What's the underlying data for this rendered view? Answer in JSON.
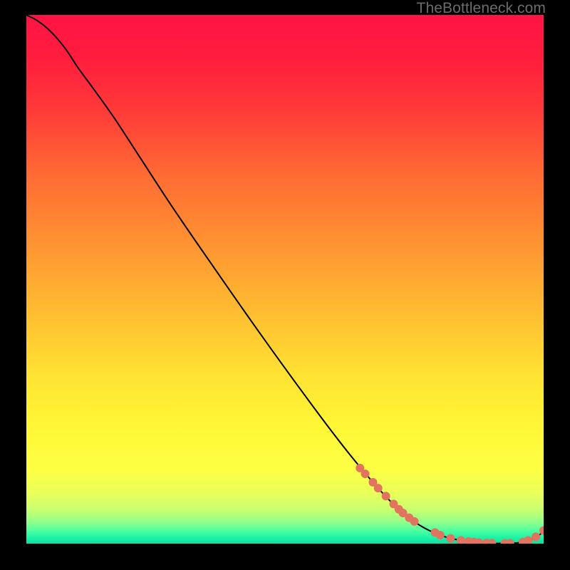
{
  "attribution": "TheBottleneck.com",
  "chart_data": {
    "type": "line",
    "title": "",
    "xlabel": "",
    "ylabel": "",
    "xlim": [
      0,
      100
    ],
    "ylim": [
      0,
      100
    ],
    "gradient_stops": [
      {
        "offset": 0.0,
        "color": "#ff1444"
      },
      {
        "offset": 0.08,
        "color": "#ff1d3e"
      },
      {
        "offset": 0.18,
        "color": "#ff3a38"
      },
      {
        "offset": 0.3,
        "color": "#ff6a34"
      },
      {
        "offset": 0.42,
        "color": "#ff8f32"
      },
      {
        "offset": 0.55,
        "color": "#ffb931"
      },
      {
        "offset": 0.68,
        "color": "#ffe233"
      },
      {
        "offset": 0.78,
        "color": "#fff735"
      },
      {
        "offset": 0.86,
        "color": "#fdff45"
      },
      {
        "offset": 0.905,
        "color": "#e9ff5a"
      },
      {
        "offset": 0.935,
        "color": "#c9ff6f"
      },
      {
        "offset": 0.958,
        "color": "#95ff88"
      },
      {
        "offset": 0.975,
        "color": "#50ffa0"
      },
      {
        "offset": 0.99,
        "color": "#18f2a6"
      },
      {
        "offset": 1.0,
        "color": "#13daa2"
      }
    ],
    "curve": {
      "x": [
        0,
        2,
        4,
        6,
        8,
        10,
        13,
        17,
        22,
        28,
        35,
        45,
        55,
        62,
        68,
        72,
        76,
        80,
        84,
        88,
        92,
        95,
        97,
        99,
        100
      ],
      "y": [
        100,
        99,
        97.5,
        95.5,
        93,
        90,
        86,
        80.5,
        73,
        64,
        54,
        40,
        26.5,
        17.5,
        10.5,
        6.5,
        3.5,
        1.6,
        0.6,
        0.1,
        0.05,
        0.15,
        0.6,
        1.5,
        2.5
      ]
    },
    "markers": {
      "x": [
        64.5,
        65.5,
        67,
        68,
        69.5,
        71,
        72,
        72.8,
        74,
        75,
        79,
        80,
        82,
        84,
        85.5,
        86.5,
        87.5,
        89,
        90,
        92.5,
        93.5,
        96,
        97,
        98.5,
        100
      ],
      "y": [
        14.3,
        13.2,
        11.6,
        10.5,
        9.0,
        7.5,
        6.5,
        5.8,
        4.9,
        4.2,
        2.1,
        1.6,
        1.0,
        0.6,
        0.4,
        0.3,
        0.2,
        0.12,
        0.08,
        0.05,
        0.06,
        0.3,
        0.6,
        1.3,
        2.5
      ],
      "color": "#e2735f",
      "radius_px": 6
    }
  }
}
